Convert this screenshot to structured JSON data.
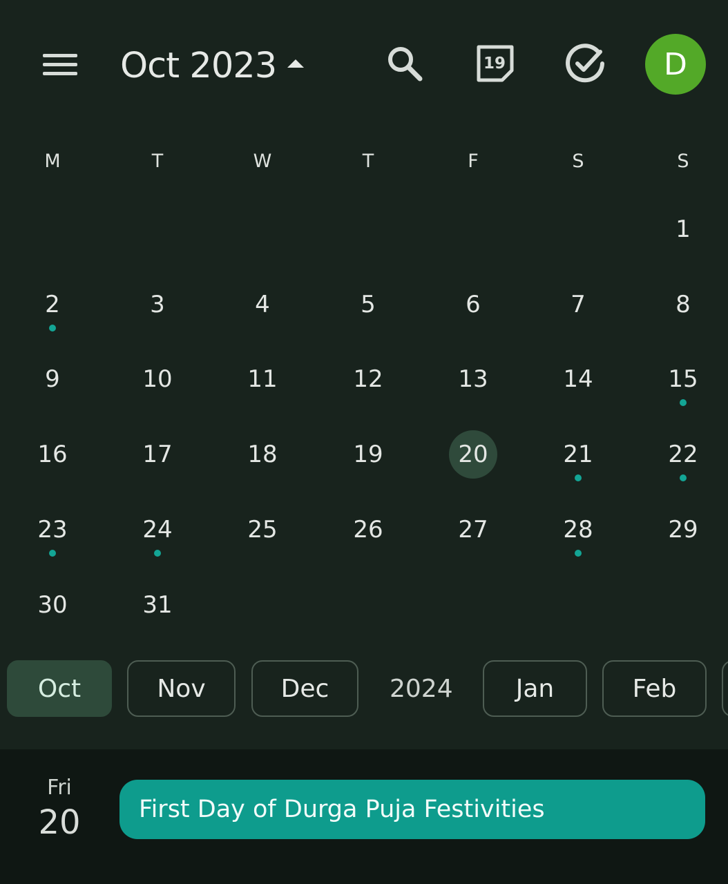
{
  "header": {
    "month_label": "Oct 2023",
    "avatar_letter": "D",
    "today_icon_number": "19"
  },
  "weekdays": [
    "M",
    "T",
    "W",
    "T",
    "F",
    "S",
    "S"
  ],
  "calendar": {
    "weeks": [
      [
        null,
        null,
        null,
        null,
        null,
        null,
        "1"
      ],
      [
        "2",
        "3",
        "4",
        "5",
        "6",
        "7",
        "8"
      ],
      [
        "9",
        "10",
        "11",
        "12",
        "13",
        "14",
        "15"
      ],
      [
        "16",
        "17",
        "18",
        "19",
        "20",
        "21",
        "22"
      ],
      [
        "23",
        "24",
        "25",
        "26",
        "27",
        "28",
        "29"
      ],
      [
        "30",
        "31",
        null,
        null,
        null,
        null,
        null
      ]
    ],
    "selected_day": "20",
    "days_with_events": [
      "2",
      "15",
      "21",
      "22",
      "23",
      "24",
      "28"
    ]
  },
  "month_chips": {
    "oct": "Oct",
    "nov": "Nov",
    "dec": "Dec",
    "year": "2024",
    "jan": "Jan",
    "feb": "Feb"
  },
  "agenda": {
    "day_of_week": "Fri",
    "date": "20",
    "event_title": "First Day of Durga Puja Festivities"
  },
  "colors": {
    "background": "#18231d",
    "event_dot": "#13a595",
    "event_chip": "#0e9c8d",
    "avatar": "#53a928",
    "selected_day": "#2f4a3b"
  }
}
